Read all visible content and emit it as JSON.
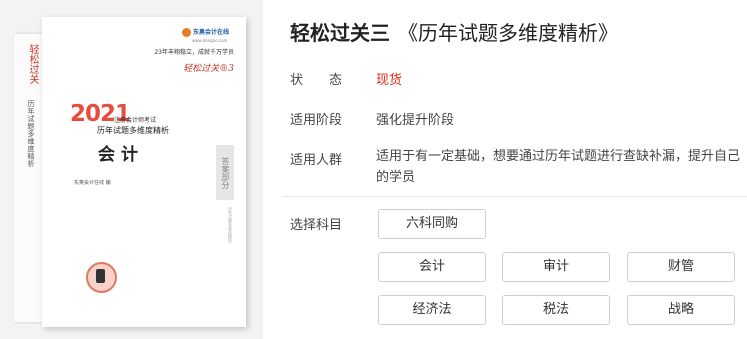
{
  "cover": {
    "spine_series": "轻松过关",
    "spine_title": "历年试题多维度精析",
    "publisher": "东奥会计在线",
    "publisher_url": "www.dongao.com",
    "slogan": "23年丰翔稳立，成就千万学员",
    "series": "轻松过关®3",
    "year": "2021",
    "exam": "注册会计师考试",
    "book_title": "历年试题多维度精析",
    "subject": "会计",
    "author": "东奥会计在线  编",
    "answer_tab": "答案部分"
  },
  "product": {
    "title_main": "轻松过关三",
    "title_sub": "《历年试题多维度精析》"
  },
  "status": {
    "label": "状　　态",
    "value": "现货",
    "value_color": "#d9291c"
  },
  "stage": {
    "label": "适用阶段",
    "value": "强化提升阶段"
  },
  "audience": {
    "label": "适用人群",
    "value": "适用于有一定基础，想要通过历年试题进行查缺补漏，提升自己的学员"
  },
  "subject_select": {
    "label": "选择科目",
    "bundle": "六科同购",
    "options": [
      "会计",
      "审计",
      "财管",
      "经济法",
      "税法",
      "战略"
    ]
  }
}
